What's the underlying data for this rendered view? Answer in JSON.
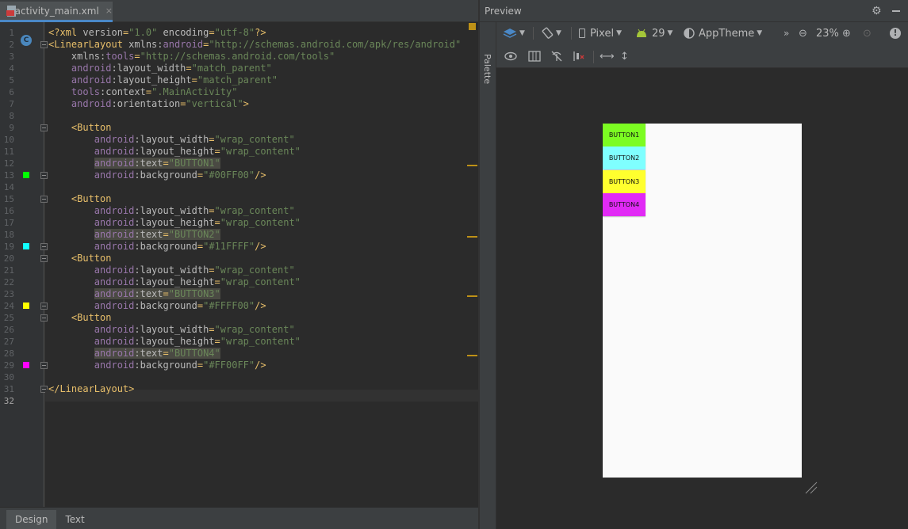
{
  "editor": {
    "tab": {
      "label": "activity_main.xml",
      "close": "×"
    },
    "current_line": "32",
    "lines": [
      {
        "n": "1",
        "parts": [
          [
            "t-tag",
            "<?xml "
          ],
          [
            "t-attr",
            "version"
          ],
          [
            "t-tag",
            "="
          ],
          [
            "t-val",
            "\"1.0\""
          ],
          [
            "t-attr",
            " encoding"
          ],
          [
            "t-tag",
            "="
          ],
          [
            "t-val",
            "\"utf-8\""
          ],
          [
            "t-tag",
            "?>"
          ]
        ]
      },
      {
        "n": "2",
        "parts": [
          [
            "t-tag",
            "<LinearLayout "
          ],
          [
            "t-attr",
            "xmlns:"
          ],
          [
            "t-ns",
            "android"
          ],
          [
            "t-tag",
            "="
          ],
          [
            "t-val",
            "\"http://schemas.android.com/apk/res/android\""
          ]
        ]
      },
      {
        "n": "3",
        "parts": [
          [
            "t-attr",
            "    xmlns:"
          ],
          [
            "t-ns",
            "tools"
          ],
          [
            "t-tag",
            "="
          ],
          [
            "t-val",
            "\"http://schemas.android.com/tools\""
          ]
        ]
      },
      {
        "n": "4",
        "parts": [
          [
            "t-ns",
            "    android"
          ],
          [
            "t-attr",
            ":layout_width"
          ],
          [
            "t-tag",
            "="
          ],
          [
            "t-val",
            "\"match_parent\""
          ]
        ]
      },
      {
        "n": "5",
        "parts": [
          [
            "t-ns",
            "    android"
          ],
          [
            "t-attr",
            ":layout_height"
          ],
          [
            "t-tag",
            "="
          ],
          [
            "t-val",
            "\"match_parent\""
          ]
        ]
      },
      {
        "n": "6",
        "parts": [
          [
            "t-ns",
            "    tools"
          ],
          [
            "t-attr",
            ":context"
          ],
          [
            "t-tag",
            "="
          ],
          [
            "t-val",
            "\".MainActivity\""
          ]
        ]
      },
      {
        "n": "7",
        "parts": [
          [
            "t-ns",
            "    android"
          ],
          [
            "t-attr",
            ":orientation"
          ],
          [
            "t-tag",
            "="
          ],
          [
            "t-val",
            "\"vertical\""
          ],
          [
            "t-tag",
            ">"
          ]
        ]
      },
      {
        "n": "8",
        "parts": []
      },
      {
        "n": "9",
        "parts": [
          [
            "t-tag",
            "    <Button"
          ]
        ]
      },
      {
        "n": "10",
        "parts": [
          [
            "t-ns",
            "        android"
          ],
          [
            "t-attr",
            ":layout_width"
          ],
          [
            "t-tag",
            "="
          ],
          [
            "t-val",
            "\"wrap_content\""
          ]
        ]
      },
      {
        "n": "11",
        "parts": [
          [
            "t-ns",
            "        android"
          ],
          [
            "t-attr",
            ":layout_height"
          ],
          [
            "t-tag",
            "="
          ],
          [
            "t-val",
            "\"wrap_content\""
          ]
        ]
      },
      {
        "n": "12",
        "parts": [
          [
            "t-attr",
            "        "
          ],
          [
            "t-ns t-hl",
            "android"
          ],
          [
            "t-attr t-hl",
            ":text"
          ],
          [
            "t-tag t-hl",
            "="
          ],
          [
            "t-val t-hl",
            "\"BUTTON1\""
          ]
        ]
      },
      {
        "n": "13",
        "parts": [
          [
            "t-ns",
            "        android"
          ],
          [
            "t-attr",
            ":background"
          ],
          [
            "t-tag",
            "="
          ],
          [
            "t-val",
            "\"#00FF00\""
          ],
          [
            "t-tag",
            "/>"
          ]
        ]
      },
      {
        "n": "14",
        "parts": []
      },
      {
        "n": "15",
        "parts": [
          [
            "t-tag",
            "    <Button"
          ]
        ]
      },
      {
        "n": "16",
        "parts": [
          [
            "t-ns",
            "        android"
          ],
          [
            "t-attr",
            ":layout_width"
          ],
          [
            "t-tag",
            "="
          ],
          [
            "t-val",
            "\"wrap_content\""
          ]
        ]
      },
      {
        "n": "17",
        "parts": [
          [
            "t-ns",
            "        android"
          ],
          [
            "t-attr",
            ":layout_height"
          ],
          [
            "t-tag",
            "="
          ],
          [
            "t-val",
            "\"wrap_content\""
          ]
        ]
      },
      {
        "n": "18",
        "parts": [
          [
            "t-attr",
            "        "
          ],
          [
            "t-ns t-hl",
            "android"
          ],
          [
            "t-attr t-hl",
            ":text"
          ],
          [
            "t-tag t-hl",
            "="
          ],
          [
            "t-val t-hl",
            "\"BUTTON2\""
          ]
        ]
      },
      {
        "n": "19",
        "parts": [
          [
            "t-ns",
            "        android"
          ],
          [
            "t-attr",
            ":background"
          ],
          [
            "t-tag",
            "="
          ],
          [
            "t-val",
            "\"#11FFFF\""
          ],
          [
            "t-tag",
            "/>"
          ]
        ]
      },
      {
        "n": "20",
        "parts": [
          [
            "t-tag",
            "    <Button"
          ]
        ]
      },
      {
        "n": "21",
        "parts": [
          [
            "t-ns",
            "        android"
          ],
          [
            "t-attr",
            ":layout_width"
          ],
          [
            "t-tag",
            "="
          ],
          [
            "t-val",
            "\"wrap_content\""
          ]
        ]
      },
      {
        "n": "22",
        "parts": [
          [
            "t-ns",
            "        android"
          ],
          [
            "t-attr",
            ":layout_height"
          ],
          [
            "t-tag",
            "="
          ],
          [
            "t-val",
            "\"wrap_content\""
          ]
        ]
      },
      {
        "n": "23",
        "parts": [
          [
            "t-attr",
            "        "
          ],
          [
            "t-ns t-hl",
            "android"
          ],
          [
            "t-attr t-hl",
            ":text"
          ],
          [
            "t-tag t-hl",
            "="
          ],
          [
            "t-val t-hl",
            "\"BUTTON3\""
          ]
        ]
      },
      {
        "n": "24",
        "parts": [
          [
            "t-ns",
            "        android"
          ],
          [
            "t-attr",
            ":background"
          ],
          [
            "t-tag",
            "="
          ],
          [
            "t-val",
            "\"#FFFF00\""
          ],
          [
            "t-tag",
            "/>"
          ]
        ]
      },
      {
        "n": "25",
        "parts": [
          [
            "t-tag",
            "    <Button"
          ]
        ]
      },
      {
        "n": "26",
        "parts": [
          [
            "t-ns",
            "        android"
          ],
          [
            "t-attr",
            ":layout_width"
          ],
          [
            "t-tag",
            "="
          ],
          [
            "t-val",
            "\"wrap_content\""
          ]
        ]
      },
      {
        "n": "27",
        "parts": [
          [
            "t-ns",
            "        android"
          ],
          [
            "t-attr",
            ":layout_height"
          ],
          [
            "t-tag",
            "="
          ],
          [
            "t-val",
            "\"wrap_content\""
          ]
        ]
      },
      {
        "n": "28",
        "parts": [
          [
            "t-attr",
            "        "
          ],
          [
            "t-ns t-hl",
            "android"
          ],
          [
            "t-attr t-hl",
            ":text"
          ],
          [
            "t-tag t-hl",
            "="
          ],
          [
            "t-val t-hl",
            "\"BUTTON4\""
          ]
        ]
      },
      {
        "n": "29",
        "parts": [
          [
            "t-ns",
            "        android"
          ],
          [
            "t-attr",
            ":background"
          ],
          [
            "t-tag",
            "="
          ],
          [
            "t-val",
            "\"#FF00FF\""
          ],
          [
            "t-tag",
            "/>"
          ]
        ]
      },
      {
        "n": "30",
        "parts": []
      },
      {
        "n": "31",
        "parts": [
          [
            "t-tag",
            "</LinearLayout>"
          ]
        ]
      },
      {
        "n": "32",
        "parts": []
      }
    ],
    "color_swatches": [
      "#00FF00",
      "#11FFFF",
      "#FFFF00",
      "#FF00FF"
    ],
    "bottom_tabs": [
      {
        "label": "Design",
        "active": true
      },
      {
        "label": "Text",
        "active": false
      }
    ]
  },
  "preview": {
    "title": "Preview",
    "palette_label": "Palette",
    "toolbar": {
      "device": "Pixel",
      "api": "29",
      "theme": "AppTheme",
      "zoom": "23%",
      "more": "»"
    },
    "buttons": [
      {
        "label": "BUTTON1",
        "color": "#7CFC22"
      },
      {
        "label": "BUTTON2",
        "color": "#7FFFFF"
      },
      {
        "label": "BUTTON3",
        "color": "#FFFF2E"
      },
      {
        "label": "BUTTON4",
        "color": "#E12AF5"
      }
    ]
  }
}
